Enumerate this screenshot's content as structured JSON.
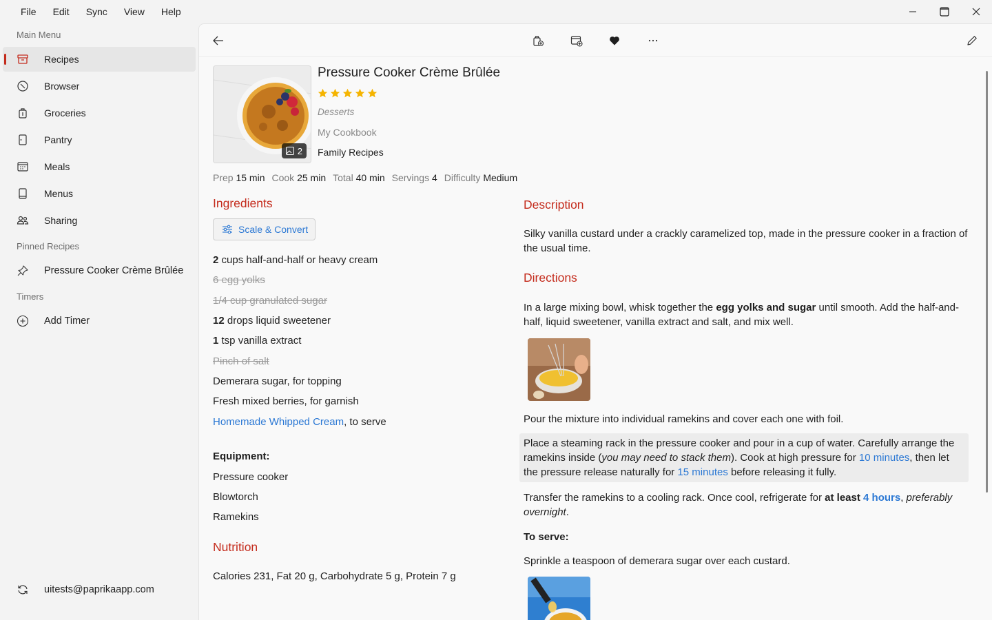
{
  "menu": {
    "items": [
      "File",
      "Edit",
      "Sync",
      "View",
      "Help"
    ]
  },
  "sidebar": {
    "main_menu_label": "Main Menu",
    "items": [
      {
        "label": "Recipes",
        "icon": "recipes-box-icon"
      },
      {
        "label": "Browser",
        "icon": "compass-icon"
      },
      {
        "label": "Groceries",
        "icon": "grocery-bag-icon"
      },
      {
        "label": "Pantry",
        "icon": "pantry-door-icon"
      },
      {
        "label": "Meals",
        "icon": "calendar-icon"
      },
      {
        "label": "Menus",
        "icon": "menu-book-icon"
      },
      {
        "label": "Sharing",
        "icon": "people-icon"
      }
    ],
    "pinned_label": "Pinned Recipes",
    "pinned_item": "Pressure Cooker Crème Brûlée",
    "timers_label": "Timers",
    "add_timer": "Add Timer",
    "account": "uitests@paprikaapp.com"
  },
  "recipe": {
    "title": "Pressure Cooker Crème Brûlée",
    "rating": 5,
    "category": "Desserts",
    "cookbook": "My Cookbook",
    "collection": "Family Recipes",
    "photo_count": "2",
    "stats": {
      "prep_label": "Prep",
      "prep": "15 min",
      "cook_label": "Cook",
      "cook": "25 min",
      "total_label": "Total",
      "total": "40 min",
      "servings_label": "Servings",
      "servings": "4",
      "difficulty_label": "Difficulty",
      "difficulty": "Medium"
    }
  },
  "ingredients": {
    "heading": "Ingredients",
    "scale_button": "Scale & Convert",
    "i1_qty": "2",
    "i1_text": "cups half-and-half or heavy cream",
    "i2_text": "6 egg yolks",
    "i3_text": "1/4 cup granulated sugar",
    "i4_qty": "12",
    "i4_text": "drops liquid sweetener",
    "i5_qty": "1",
    "i5_text": "tsp vanilla extract",
    "i6_text": "Pinch of salt",
    "i7_text": "Demerara sugar, for topping",
    "i8_text": "Fresh mixed berries, for garnish",
    "i9_link": "Homemade Whipped Cream",
    "i9_text": ", to serve"
  },
  "equipment": {
    "heading": "Equipment:",
    "items": [
      "Pressure cooker",
      "Blowtorch",
      "Ramekins"
    ]
  },
  "nutrition": {
    "heading": "Nutrition",
    "text": "Calories 231, Fat 20 g, Carbohydrate 5 g, Protein 7 g"
  },
  "description": {
    "heading": "Description",
    "text": "Silky vanilla custard under a crackly caramelized top, made in the pressure cooker in a fraction of the usual time."
  },
  "directions": {
    "heading": "Directions",
    "s1_a": "In a large mixing bowl, whisk together the ",
    "s1_b": "egg yolks and sugar",
    "s1_c": " until smooth. Add the half-and-half, liquid sweetener, vanilla extract and salt, and mix well.",
    "s2": "Pour the mixture into individual ramekins and cover each one with foil.",
    "s3_a": "Place a steaming rack in the pressure cooker and pour in a cup of water. Carefully arrange the ramekins inside (",
    "s3_b": "you may need to stack them",
    "s3_c": "). Cook at high pressure for ",
    "s3_d": "10 minutes",
    "s3_e": ", then let the pressure release naturally for ",
    "s3_f": "15 minutes",
    "s3_g": " before releasing it fully.",
    "s4_a": "Transfer the ramekins to a cooling rack. Once cool, refrigerate for ",
    "s4_b": "at least",
    "s4_c": " ",
    "s4_d": "4 hours",
    "s4_e": ", ",
    "s4_f": "preferably overnight",
    "s4_g": ".",
    "to_serve": "To serve:",
    "s5": "Sprinkle a teaspoon of demerara sugar over each custard."
  },
  "colors": {
    "accent_red": "#c42b1c",
    "link_blue": "#2b78d4",
    "star_gold": "#f5b400"
  }
}
